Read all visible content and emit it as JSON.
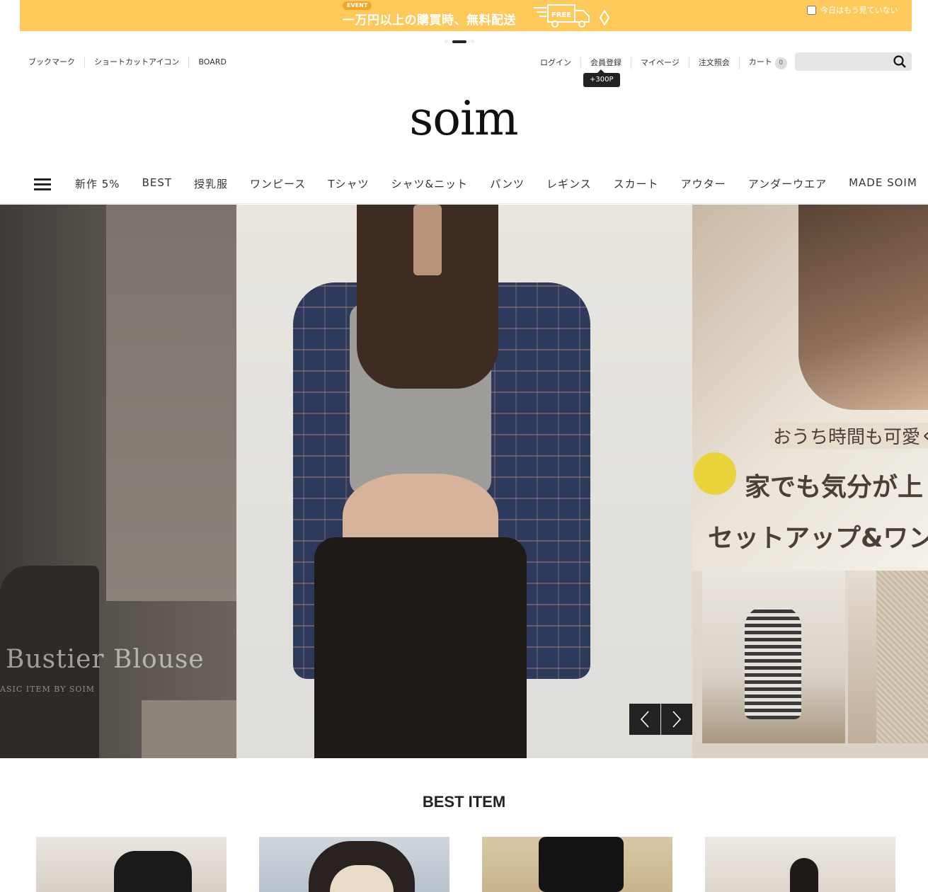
{
  "banner": {
    "tag": "EVENT",
    "text": "一万円以上の購買時、無料配送",
    "truck_label": "FREE",
    "hide_today": "今日はもう見ていない",
    "color": "#fdc95a"
  },
  "util_left": [
    "ブックマーク",
    "ショートカットアイコン",
    "BOARD"
  ],
  "util_right": {
    "login": "ログイン",
    "join": "会員登録",
    "join_point": "+300P",
    "mypage": "マイページ",
    "order": "注文照会",
    "cart": "カート",
    "cart_count": "0"
  },
  "search": {
    "placeholder": "",
    "icon": "search-icon"
  },
  "logo": "soim",
  "nav": {
    "menu_icon": "hamburger-icon",
    "items": [
      "新作 5%",
      "BEST",
      "授乳服",
      "ワンピース",
      "Tシャツ",
      "シャツ&ニット",
      "パンツ",
      "レギンス",
      "スカート",
      "アウター",
      "アンダーウエア",
      "MADE SOIM"
    ]
  },
  "hero": {
    "left_title": "Bustier Blouse",
    "left_sub": "ASIC ITEM BY SOIM",
    "right_line1": "おうち時間も可愛く",
    "right_line2": "家でも気分が上",
    "right_line3": "セットアップ&ワン",
    "prev_icon": "chevron-left-icon",
    "next_icon": "chevron-right-icon"
  },
  "best": {
    "title": "BEST ITEM"
  }
}
